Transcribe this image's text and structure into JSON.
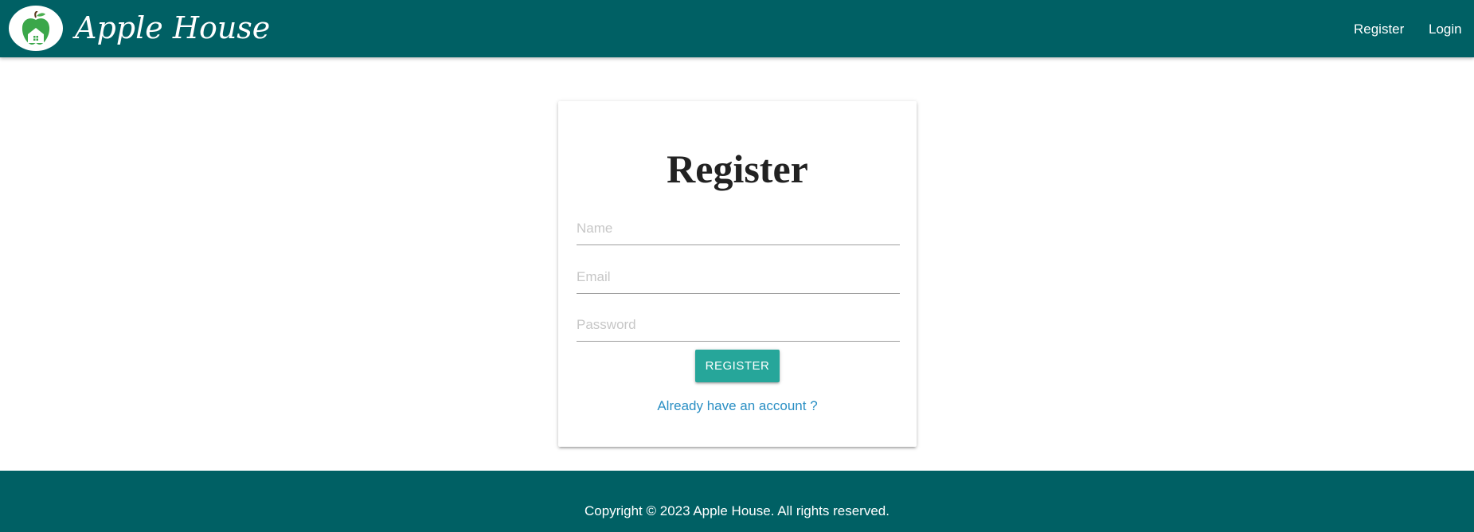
{
  "header": {
    "brand": "Apple House",
    "nav": {
      "register_label": "Register",
      "login_label": "Login"
    }
  },
  "form": {
    "title": "Register",
    "name_placeholder": "Name",
    "email_placeholder": "Email",
    "password_placeholder": "Password",
    "submit_label": "REGISTER",
    "login_link": "Already have an account ?"
  },
  "footer": {
    "copyright": "Copyright © 2023 Apple House. All rights reserved."
  },
  "colors": {
    "primary": "#006064",
    "accent": "#26a69a",
    "link": "#2a8fc4"
  },
  "icons": {
    "logo": "apple-house-logo"
  }
}
